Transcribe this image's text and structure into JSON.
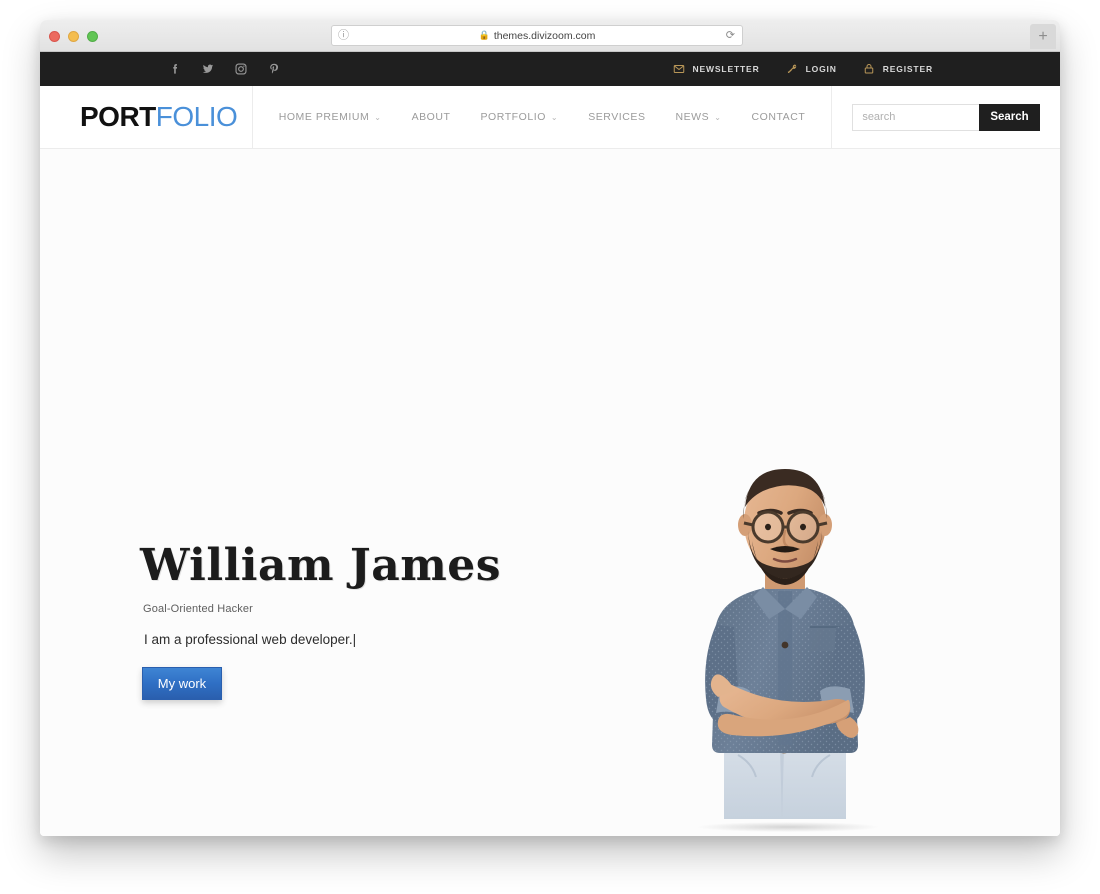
{
  "browser": {
    "url": "themes.divizoom.com",
    "lock_icon": "lock-icon",
    "info_icon": "info-circle-icon",
    "reload_icon": "reload-icon",
    "new_tab_label": "+",
    "traffic_lights": [
      "close-red",
      "minimize-yellow",
      "maximize-green"
    ]
  },
  "topbar": {
    "social": [
      {
        "name": "facebook-icon",
        "label": "f"
      },
      {
        "name": "twitter-icon",
        "label": "t"
      },
      {
        "name": "instagram-icon",
        "label": "i"
      },
      {
        "name": "pinterest-icon",
        "label": "p"
      }
    ],
    "links": [
      {
        "label": "NEWSLETTER",
        "icon": "envelope-icon"
      },
      {
        "label": "LOGIN",
        "icon": "key-icon"
      },
      {
        "label": "REGISTER",
        "icon": "lock-icon"
      }
    ],
    "background": "#1f1f1f",
    "icon_accent": "#b99758"
  },
  "header": {
    "logo": {
      "primary": "PORT",
      "secondary": "FOLIO",
      "primary_color": "#111111",
      "secondary_color": "#4a90d9"
    },
    "nav": [
      {
        "label": "HOME PREMIUM",
        "has_dropdown": true
      },
      {
        "label": "ABOUT",
        "has_dropdown": false
      },
      {
        "label": "PORTFOLIO",
        "has_dropdown": true
      },
      {
        "label": "SERVICES",
        "has_dropdown": false
      },
      {
        "label": "NEWS",
        "has_dropdown": true
      },
      {
        "label": "CONTACT",
        "has_dropdown": false
      }
    ],
    "chevron": "⌄",
    "search": {
      "value": "",
      "placeholder": "search",
      "button_label": "Search"
    }
  },
  "hero": {
    "name": "William James",
    "subtitle": "Goal-Oriented Hacker",
    "typed_text": "I am a professional web developer.",
    "caret": "|",
    "cta_label": "My work",
    "cta_color": "#2f6fc4",
    "background": "#fcfcfc",
    "image_alt": "bearded-man-glasses-denim-shirt-arms-crossed"
  }
}
